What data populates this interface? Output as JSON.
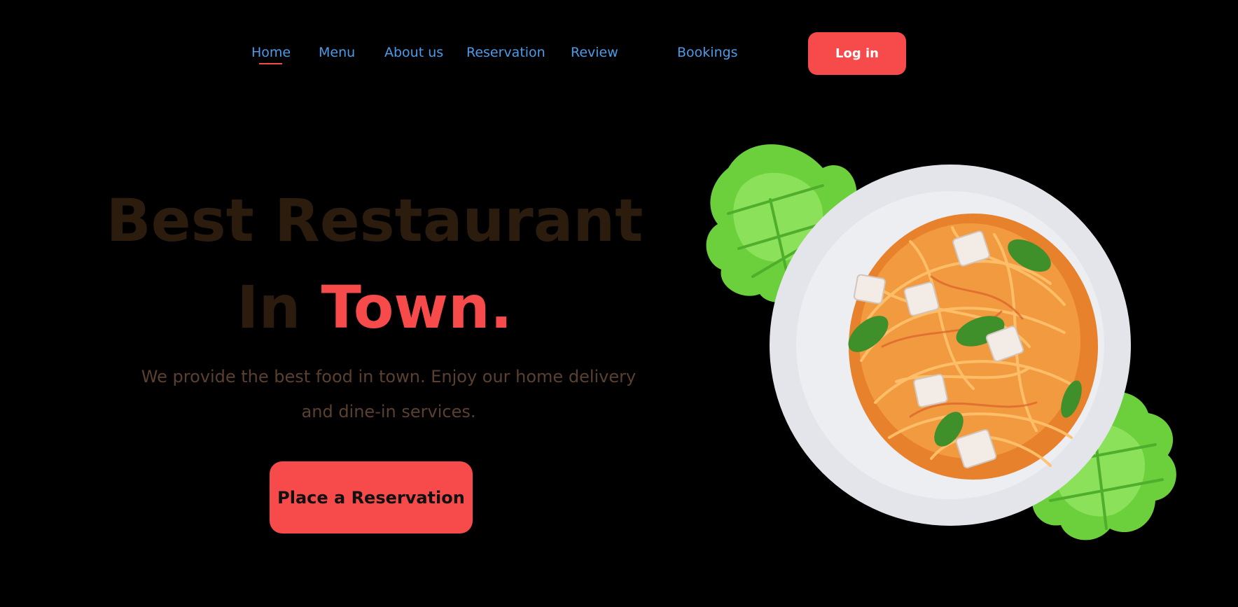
{
  "nav": {
    "items": [
      {
        "label": "Home"
      },
      {
        "label": "Menu"
      },
      {
        "label": "About us"
      },
      {
        "label": "Reservation"
      },
      {
        "label": "Review"
      },
      {
        "label": "Bookings"
      }
    ],
    "active_index": 0,
    "login_label": "Log in"
  },
  "hero": {
    "headline_line1": "Best Restaurant",
    "headline_line2_prefix": "In ",
    "headline_line2_accent": "Town.",
    "description_line1": "We provide the best food in town. Enjoy our home delivery",
    "description_line2": "and dine-in services.",
    "cta_label": "Place a Reservation"
  },
  "colors": {
    "background": "#000000",
    "accent": "#f74a4a",
    "nav_link": "#4a9be8",
    "headline": "#2b1c0e",
    "description": "#5a4030"
  },
  "image": {
    "icon": "spaghetti-plate-image"
  }
}
